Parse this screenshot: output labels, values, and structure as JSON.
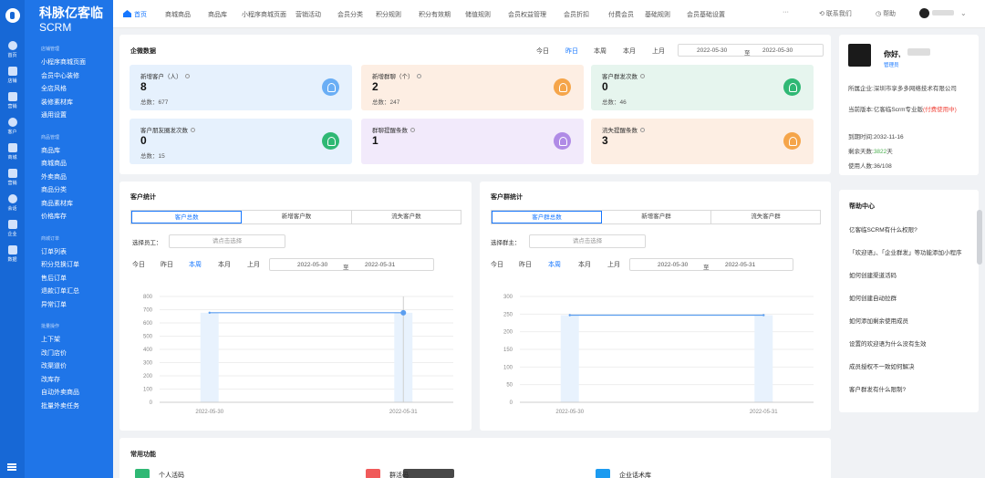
{
  "rail": {
    "items": [
      {
        "label": "首页",
        "icon": "compass-icon"
      },
      {
        "label": "店铺",
        "icon": "shop-icon"
      },
      {
        "label": "营销",
        "icon": "megaphone-icon"
      },
      {
        "label": "客户",
        "icon": "user-icon"
      },
      {
        "label": "商城",
        "icon": "mail-icon"
      },
      {
        "label": "营销",
        "icon": "tag-icon"
      },
      {
        "label": "会话",
        "icon": "chat-icon"
      },
      {
        "label": "企业",
        "icon": "building-icon"
      },
      {
        "label": "数据",
        "icon": "chart-icon"
      }
    ]
  },
  "sidebar": {
    "brand_line1": "科脉亿客临",
    "brand_line2": "SCRM",
    "groups": [
      {
        "title": "店铺管理",
        "items": [
          "小程序商城页面",
          "会员中心装修",
          "全店风格",
          "装修素材库",
          "通用设置"
        ]
      },
      {
        "title": "商品管理",
        "items": [
          "商品库",
          "商城商品",
          "外卖商品",
          "商品分类",
          "商品素材库",
          "价格库存"
        ]
      },
      {
        "title": "商城订单",
        "items": [
          "订单列表",
          "积分兑换订单",
          "售后订单",
          "退款订单汇总",
          "异常订单"
        ]
      },
      {
        "title": "批量操作",
        "items": [
          "上下架",
          "改门店价",
          "改渠道价",
          "改库存",
          "自动外卖商品",
          "批量外卖任务"
        ]
      }
    ]
  },
  "topnav": {
    "tabs": [
      "首页",
      "商城商品",
      "商品库",
      "小程序商城页面",
      "营销活动",
      "会员分类",
      "积分规则",
      "积分有效期",
      "储值规则",
      "会员权益管理",
      "会员折扣",
      "付费会员",
      "基础规则",
      "会员基础设置"
    ],
    "more": "···",
    "contact": "联系我们",
    "help": "帮助"
  },
  "enterprise": {
    "title": "企微数据",
    "periods": [
      "今日",
      "昨日",
      "本周",
      "本月",
      "上月"
    ],
    "active_period": "昨日",
    "date_from": "2022-05-30",
    "date_sep": "至",
    "date_to": "2022-05-30",
    "metrics": [
      {
        "label": "新增客户（人）",
        "value": "8",
        "total": "总数：677",
        "color": "#6aaef5",
        "bg": "#e6f1fd",
        "icon": "user-group-icon"
      },
      {
        "label": "新增群聊（个）",
        "value": "2",
        "total": "总数：247",
        "color": "#f5a54a",
        "bg": "#fdeee3",
        "icon": "group-chat-icon"
      },
      {
        "label": "客户群发次数",
        "value": "0",
        "total": "总数：46",
        "color": "#2fb874",
        "bg": "#e6f5ee",
        "icon": "broadcast-icon"
      },
      {
        "label": "客户朋友圈发次数",
        "value": "0",
        "total": "总数：15",
        "color": "#2fb874",
        "bg": "#e6f1fd",
        "icon": "moments-icon"
      },
      {
        "label": "群聊提醒条数",
        "value": "1",
        "total": "",
        "color": "#b08be6",
        "bg": "#f2eafb",
        "icon": "list-icon"
      },
      {
        "label": "流失提醒条数",
        "value": "3",
        "total": "",
        "color": "#f5a54a",
        "bg": "#fdeee3",
        "icon": "bell-icon"
      }
    ]
  },
  "customer_stats": {
    "title": "客户统计",
    "seg": [
      "客户总数",
      "新增客户数",
      "流失客户数"
    ],
    "active_seg": "客户总数",
    "select_label": "选择员工：",
    "select_placeholder": "请点击选择",
    "periods": [
      "今日",
      "昨日",
      "本周",
      "本月",
      "上月"
    ],
    "active_period": "本周",
    "date_from": "2022-05-30",
    "date_sep": "至",
    "date_to": "2022-05-31"
  },
  "group_stats": {
    "title": "客户群统计",
    "seg": [
      "客户群总数",
      "新增客户群",
      "流失客户群"
    ],
    "active_seg": "客户群总数",
    "select_label": "选择群主：",
    "select_placeholder": "请点击选择",
    "periods": [
      "今日",
      "昨日",
      "本周",
      "本月",
      "上月"
    ],
    "active_period": "本周",
    "date_from": "2022-05-30",
    "date_sep": "至",
    "date_to": "2022-05-31"
  },
  "chart_data": [
    {
      "type": "line",
      "x": [
        "2022-05-30",
        "2022-05-31"
      ],
      "series": [
        {
          "values": [
            677,
            677
          ]
        }
      ],
      "yticks": [
        0,
        100,
        200,
        300,
        400,
        500,
        600,
        700,
        800
      ],
      "ylim": [
        0,
        800
      ],
      "title": "",
      "xlabel": "",
      "ylabel": ""
    },
    {
      "type": "line",
      "x": [
        "2022-05-30",
        "2022-05-31"
      ],
      "series": [
        {
          "values": [
            247,
            247
          ]
        }
      ],
      "yticks": [
        0,
        50,
        100,
        150,
        200,
        250,
        300
      ],
      "ylim": [
        0,
        300
      ],
      "title": "",
      "xlabel": "",
      "ylabel": ""
    }
  ],
  "profile": {
    "greeting": "你好,",
    "role": "管理员",
    "company_label": "所属企业:",
    "company": "深圳市享多多网络技术有限公司",
    "version_label": "当前版本:",
    "version": "亿客临Scrm专业版",
    "version_note": "(付费使用中)",
    "expire_label": "到期时间:",
    "expire": "2032-11-16",
    "days_label": "剩余天数:",
    "days": "3822",
    "days_unit": "天",
    "users_label": "使用人数:",
    "users": "36/108"
  },
  "help_center": {
    "title": "帮助中心",
    "items": [
      "亿客临SCRM有什么权限?",
      "「欢迎语」、「企业群发」等功能添加小程序",
      "如何创建渠道活码",
      "如何创建自动拉群",
      "如何添加剩余使用成员",
      "设置的欢迎语为什么没有生效",
      "成员授权不一致如何解决",
      "客户群发有什么限制?"
    ]
  },
  "common_funcs": {
    "title": "常用功能",
    "items": [
      {
        "label": "个人活码",
        "color": "#2fb874",
        "icon": "qrcode-icon"
      },
      {
        "label": "群活码",
        "color": "#f05a5a",
        "icon": "group-qrcode-icon"
      },
      {
        "label": "企业话术库",
        "color": "#1c9bf0",
        "icon": "script-library-icon"
      }
    ]
  }
}
